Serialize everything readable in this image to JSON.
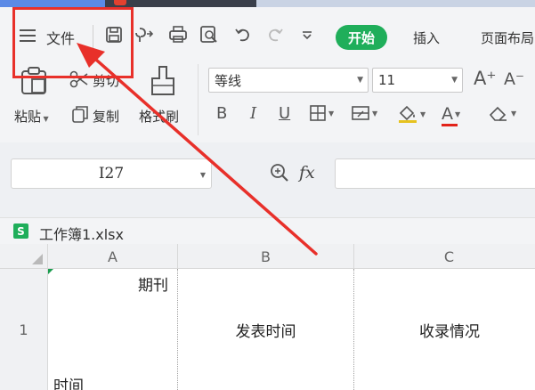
{
  "menu": {
    "file_label": "文件",
    "tabs": [
      "开始",
      "插入",
      "页面布局"
    ],
    "icons": [
      "menu-icon",
      "save-icon",
      "export-icon",
      "print-icon",
      "print-preview-icon",
      "undo-icon",
      "redo-icon",
      "customize-dropdown-icon"
    ]
  },
  "ribbon": {
    "paste_label": "粘贴",
    "cut_label": "剪切",
    "copy_label": "复制",
    "format_painter_label": "格式刷",
    "font_name": "等线",
    "font_size": "11",
    "grow_font": "A⁺",
    "shrink_font": "A⁻",
    "bold": "B",
    "italic": "I",
    "underline": "U",
    "font_color_letter": "A"
  },
  "formula_bar": {
    "cell_ref": "I27",
    "fx_label": "fx",
    "value": ""
  },
  "workbook": {
    "icon_letter": "S",
    "name": "工作簿1.xlsx"
  },
  "grid": {
    "columns": [
      "A",
      "B",
      "C"
    ],
    "rows": [
      "1"
    ],
    "cells": {
      "A1_top": "期刊",
      "A1_bottom": "时间",
      "B1": "发表时间",
      "C1": "收录情况"
    }
  },
  "colors": {
    "accent_green": "#1fae5a",
    "annotation_red": "#e8302a",
    "ribbon_bg": "#f3f4f6"
  }
}
